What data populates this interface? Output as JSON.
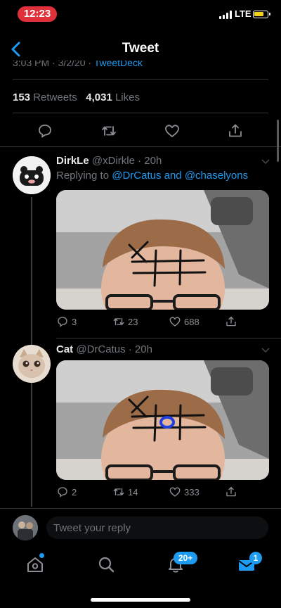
{
  "status_bar": {
    "time": "12:23",
    "network": "LTE"
  },
  "header": {
    "title": "Tweet"
  },
  "tweet_meta": {
    "datetime": "3:03 PM · 3/2/20 ·",
    "source": "TweetDeck"
  },
  "stats": {
    "retweets_count": "153",
    "retweets_label": "Retweets",
    "likes_count": "4,031",
    "likes_label": "Likes"
  },
  "replies": [
    {
      "display_name": "DirkLe",
      "handle": "@xDirkle",
      "time": "20h",
      "replying_prefix": "Replying to",
      "mentions": "@DrCatus and @chaselyons",
      "reply_count": "3",
      "retweet_count": "23",
      "like_count": "688"
    },
    {
      "display_name": "Cat",
      "handle": "@DrCatus",
      "time": "20h",
      "reply_count": "2",
      "retweet_count": "14",
      "like_count": "333"
    }
  ],
  "composer": {
    "placeholder": "Tweet your reply"
  },
  "tabbar": {
    "notifications_badge": "20+",
    "messages_badge": "1"
  },
  "colors": {
    "accent": "#1d9bf0",
    "background": "#000000",
    "time_pill": "#e0313b",
    "ink": "#1a1a1a",
    "circle_mark": "#1f3fe0"
  }
}
